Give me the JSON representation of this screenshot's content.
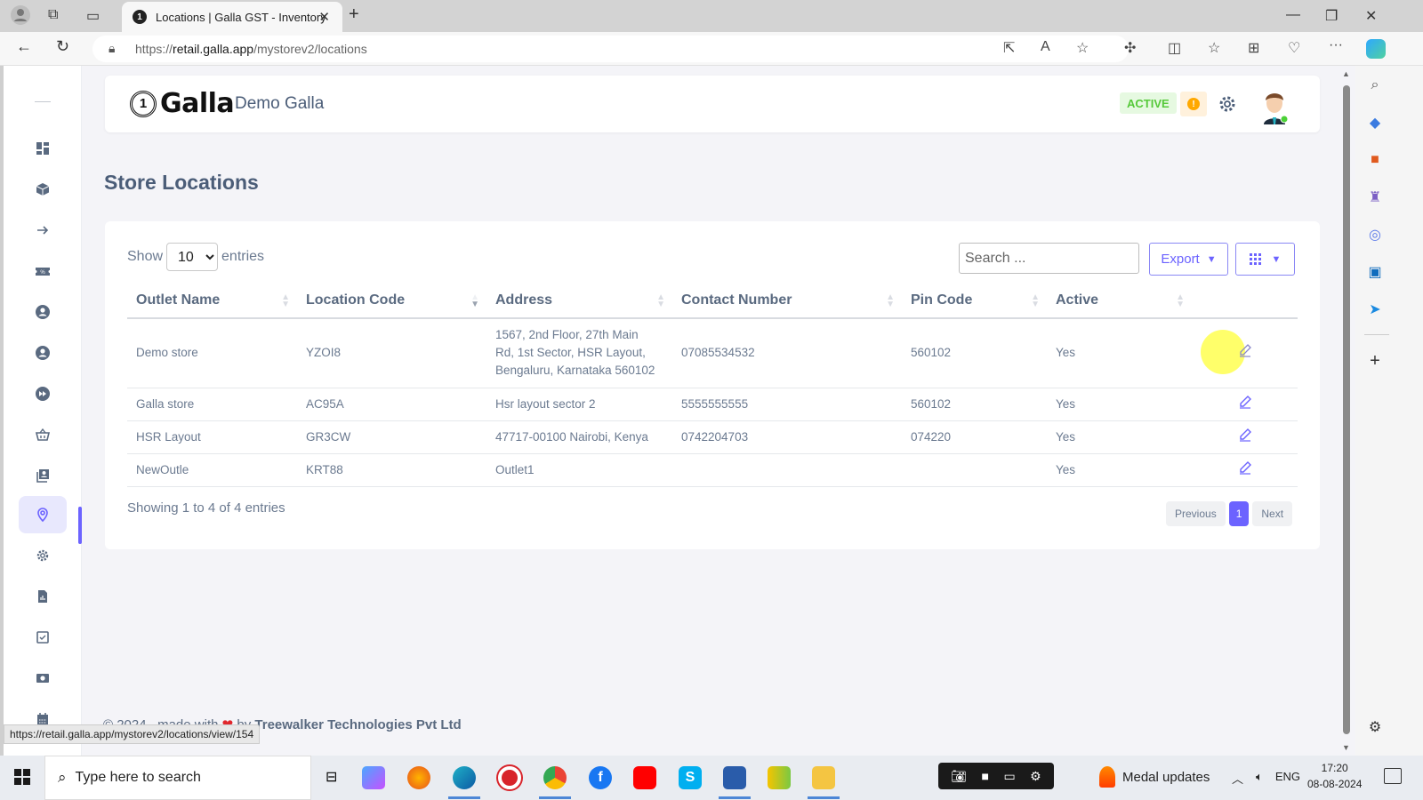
{
  "browser": {
    "tab_title": "Locations | Galla GST - Inventory",
    "url_prefix": "https://",
    "url_host": "retail.galla.app",
    "url_path": "/mystorev2/locations",
    "status_url": "https://retail.galla.app/mystorev2/locations/view/154"
  },
  "header": {
    "logo_text": "Galla",
    "logo_mark": "1",
    "store_name": "Demo Galla",
    "status_badge": "ACTIVE",
    "alert_glyph": "!"
  },
  "sidebar": {
    "items": [
      {
        "name": "dashboard",
        "icon": "dashboard-icon"
      },
      {
        "name": "products",
        "icon": "cube-icon"
      },
      {
        "name": "transfer",
        "icon": "arrow-right-icon"
      },
      {
        "name": "discounts",
        "icon": "ticket-icon"
      },
      {
        "name": "customers",
        "icon": "user-circle-icon"
      },
      {
        "name": "users",
        "icon": "user-circle-icon"
      },
      {
        "name": "forward",
        "icon": "fast-forward-icon"
      },
      {
        "name": "purchases",
        "icon": "basket-icon"
      },
      {
        "name": "contacts",
        "icon": "contact-book-icon"
      },
      {
        "name": "locations",
        "icon": "location-pin-icon",
        "active": true
      },
      {
        "name": "settings",
        "icon": "gear-icon"
      },
      {
        "name": "reports",
        "icon": "report-icon"
      },
      {
        "name": "tasks",
        "icon": "checkbox-icon"
      },
      {
        "name": "cash",
        "icon": "cash-icon"
      },
      {
        "name": "calendar",
        "icon": "calendar-icon"
      }
    ]
  },
  "main": {
    "page_title": "Store Locations",
    "show_label": "Show",
    "entries_label": "entries",
    "entries_value": "10",
    "search_placeholder": "Search ...",
    "export_label": "Export",
    "table": {
      "columns": [
        "Outlet Name",
        "Location Code",
        "Address",
        "Contact Number",
        "Pin Code",
        "Active",
        ""
      ],
      "rows": [
        {
          "outlet": "Demo store",
          "code": "YZOI8",
          "address": "1567, 2nd Floor, 27th Main Rd, 1st Sector, HSR Layout, Bengaluru, Karnataka 560102",
          "contact": "07085534532",
          "pin": "560102",
          "active": "Yes"
        },
        {
          "outlet": "Galla store",
          "code": "AC95A",
          "address": "Hsr layout sector 2",
          "contact": "5555555555",
          "pin": "560102",
          "active": "Yes"
        },
        {
          "outlet": "HSR Layout",
          "code": "GR3CW",
          "address": "47717-00100 Nairobi, Kenya",
          "contact": "0742204703",
          "pin": "074220",
          "active": "Yes"
        },
        {
          "outlet": "NewOutle",
          "code": "KRT88",
          "address": "Outlet1",
          "contact": "",
          "pin": "",
          "active": "Yes"
        }
      ]
    },
    "showing_text": "Showing 1 to 4 of 4 entries",
    "pagination": {
      "previous": "Previous",
      "current": "1",
      "next": "Next"
    }
  },
  "footer": {
    "prefix": "© 2024 , made with",
    "by": "by",
    "company": "Treewalker Technologies Pvt Ltd"
  },
  "taskbar": {
    "search_placeholder": "Type here to search",
    "medal_text": "Medal updates",
    "language": "ENG",
    "time": "17:20",
    "date": "08-08-2024"
  },
  "colors": {
    "accent": "#6c63ff",
    "active_badge_bg": "#e6f9e1",
    "active_badge_text": "#56c93a",
    "alert": "#ffa800",
    "heading": "#4b5d78"
  }
}
